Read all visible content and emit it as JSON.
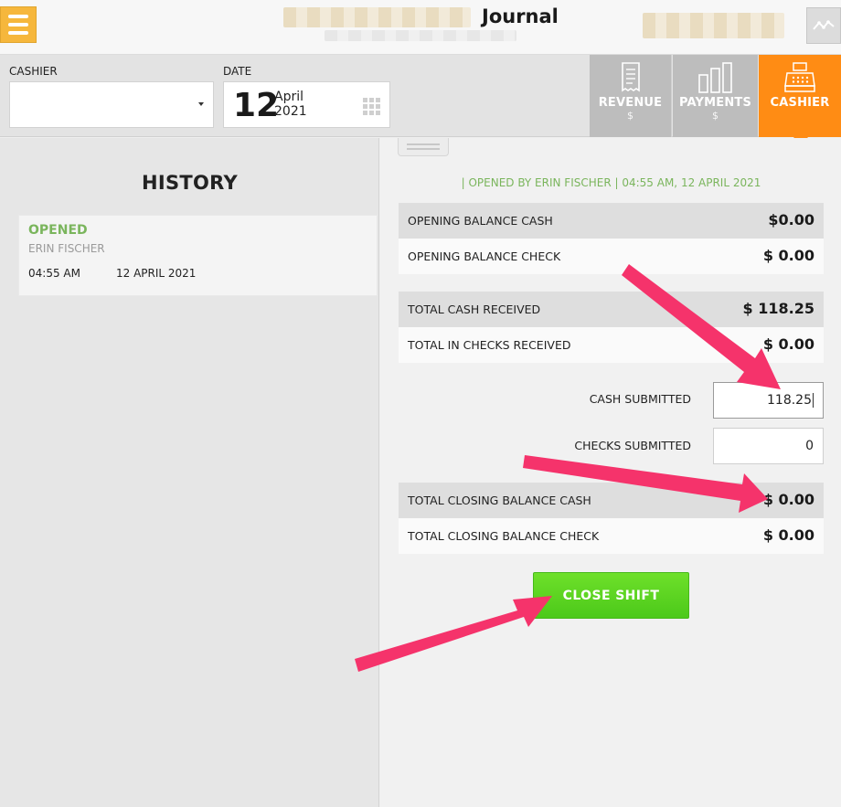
{
  "header": {
    "title": "Journal"
  },
  "filters": {
    "cashier_label": "CASHIER",
    "cashier_value": "",
    "date_label": "DATE",
    "date_day": "12",
    "date_month": "April",
    "date_year": "2021"
  },
  "tabs": [
    {
      "label": "REVENUE",
      "sub": "$",
      "icon": "receipt-icon"
    },
    {
      "label": "PAYMENTS",
      "sub": "$",
      "icon": "bar-chart-icon"
    },
    {
      "label": "CASHIER",
      "sub": "",
      "icon": "cash-register-icon",
      "active": true
    }
  ],
  "history": {
    "title": "HISTORY",
    "entries": [
      {
        "status": "OPENED",
        "name": "ERIN FISCHER",
        "time": "04:55 AM",
        "date": "12 APRIL 2021"
      }
    ]
  },
  "shift": {
    "opened_by": "| OPENED BY ERIN FISCHER | 04:55 AM, 12 APRIL 2021",
    "rows": [
      {
        "label": "OPENING BALANCE CASH",
        "value": "$0.00"
      },
      {
        "label": "OPENING BALANCE CHECK",
        "value": "$ 0.00"
      },
      {
        "label": "TOTAL CASH RECEIVED",
        "value": "$ 118.25"
      },
      {
        "label": "TOTAL IN CHECKS RECEIVED",
        "value": "$ 0.00"
      },
      {
        "label": "TOTAL CLOSING BALANCE CASH",
        "value": "$ 0.00"
      },
      {
        "label": "TOTAL CLOSING BALANCE CHECK",
        "value": "$ 0.00"
      }
    ],
    "cash_submitted_label": "CASH SUBMITTED",
    "cash_submitted_value": "118.25",
    "checks_submitted_label": "CHECKS SUBMITTED",
    "checks_submitted_value": "0",
    "close_button": "CLOSE SHIFT"
  },
  "colors": {
    "accent_orange": "#ff8c14",
    "menu_yellow": "#f6b73c",
    "status_green": "#7ab55c",
    "button_green": "#5ad41f",
    "annotation_pink": "#f5336b"
  }
}
